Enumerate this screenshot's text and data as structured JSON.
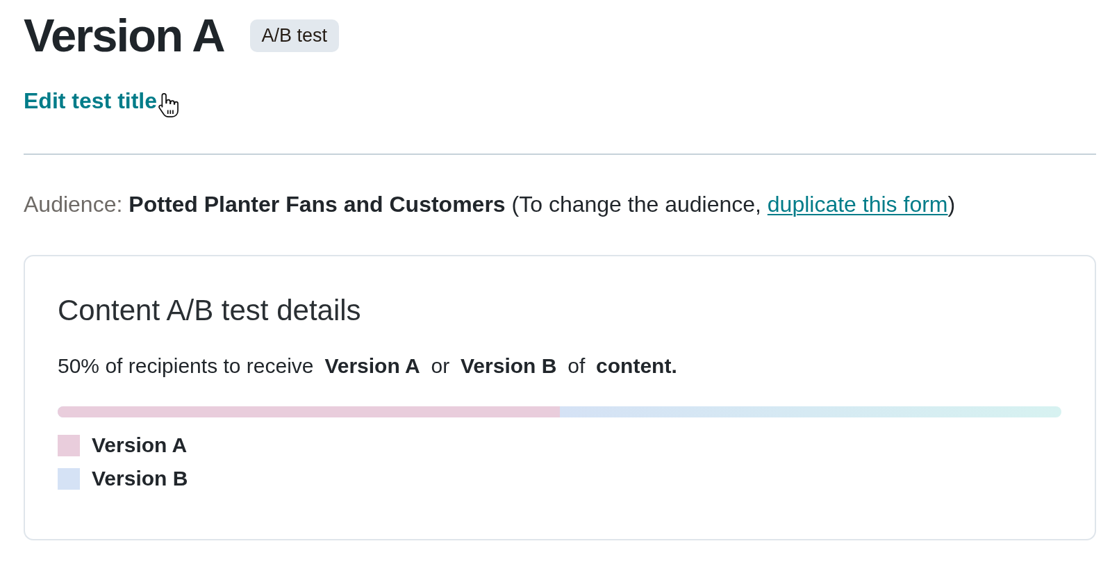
{
  "header": {
    "title": "Version A",
    "badge": "A/B test",
    "edit_link": "Edit test title"
  },
  "audience": {
    "label": "Audience:",
    "text_before": "**Potted Planter Fans and Customers** (To change the audience, ",
    "link": "duplicate this form",
    "text_after": ")"
  },
  "details_card": {
    "title": "Content A/B test details",
    "summary": "50% of recipients to receive **Version A** or **Version B** of **content.**",
    "split_bar": {
      "level": 0.5
    },
    "legend": [
      {
        "label": "Version A",
        "color": "#e9cddc"
      },
      {
        "label": "Version B",
        "color": "#d5e2f5"
      }
    ]
  }
}
